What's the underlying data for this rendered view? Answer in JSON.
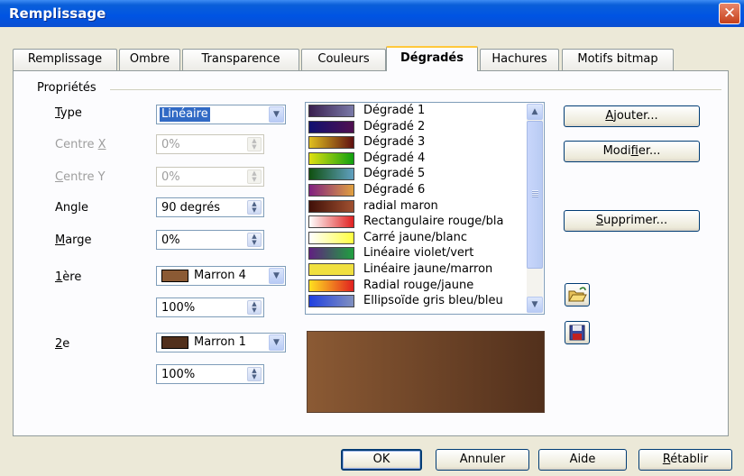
{
  "window": {
    "title": "Remplissage",
    "close_glyph": "✕"
  },
  "tabs": [
    {
      "label": "Remplissage",
      "active": false
    },
    {
      "label": "Ombre",
      "active": false
    },
    {
      "label": "Transparence",
      "active": false
    },
    {
      "label": "Couleurs",
      "active": false
    },
    {
      "label": "Dégradés",
      "active": true
    },
    {
      "label": "Hachures",
      "active": false
    },
    {
      "label": "Motifs bitmap",
      "active": false
    }
  ],
  "properties": {
    "group_label": "Propriétés",
    "type": {
      "label_pre": "",
      "label_u": "T",
      "label_post": "ype",
      "value": "Linéaire"
    },
    "center_x": {
      "label_pre": "Centre ",
      "label_u": "X",
      "label_post": "",
      "value": "0%",
      "enabled": false
    },
    "center_y": {
      "label_pre": "",
      "label_u": "C",
      "label_post": "entre Y",
      "value": "0%",
      "enabled": false
    },
    "angle": {
      "label_pre": "",
      "label_u": "",
      "label_post": "Angle",
      "value": "90 degrés"
    },
    "margin": {
      "label_pre": "",
      "label_u": "M",
      "label_post": "arge",
      "value": "0%"
    },
    "first": {
      "label_pre": "",
      "label_u": "1",
      "label_post": "ère",
      "color_name": "Marron 4",
      "color": "#8b5a34",
      "intensity": "100%"
    },
    "second": {
      "label_pre": "",
      "label_u": "2",
      "label_post": "e",
      "color_name": "Marron 1",
      "color": "#52301c",
      "intensity": "100%"
    }
  },
  "gradients": [
    {
      "name": "Dégradé 1",
      "c1": "#3a2050",
      "c2": "#7a7aa8"
    },
    {
      "name": "Dégradé 2",
      "c1": "#101070",
      "c2": "#501050"
    },
    {
      "name": "Dégradé 3",
      "c1": "#e0c020",
      "c2": "#601010"
    },
    {
      "name": "Dégradé 4",
      "c1": "#e0e010",
      "c2": "#10a010"
    },
    {
      "name": "Dégradé 5",
      "c1": "#105010",
      "c2": "#60a0c0"
    },
    {
      "name": "Dégradé 6",
      "c1": "#802080",
      "c2": "#e0a040"
    },
    {
      "name": "radial maron",
      "c1": "#401008",
      "c2": "#a05030"
    },
    {
      "name": "Rectangulaire rouge/bla",
      "c1": "#ffffff",
      "c2": "#e02020"
    },
    {
      "name": "Carré jaune/blanc",
      "c1": "#ffffff",
      "c2": "#ffff40"
    },
    {
      "name": "Linéaire violet/vert",
      "c1": "#602080",
      "c2": "#20a040"
    },
    {
      "name": "Linéaire jaune/marron",
      "c1": "#f0e040",
      "c2": "#f0e040"
    },
    {
      "name": "Radial rouge/jaune",
      "c1": "#ffe020",
      "c2": "#e02020"
    },
    {
      "name": "Ellipsoïde gris bleu/bleu",
      "c1": "#2040e0",
      "c2": "#8090c0"
    }
  ],
  "buttons": {
    "add": {
      "pre": "",
      "u": "A",
      "post": "jouter..."
    },
    "modify": {
      "pre": "Modi",
      "u": "f",
      "post": "ier..."
    },
    "delete": {
      "pre": "",
      "u": "S",
      "post": "upprimer..."
    },
    "ok": "OK",
    "cancel": "Annuler",
    "help": "Aide",
    "reset": {
      "pre": "",
      "u": "R",
      "post": "établir"
    }
  },
  "icons": {
    "open": "folder-open-icon",
    "save": "floppy-save-icon"
  },
  "colors": {
    "accent": "#0054e3",
    "preview_start": "#8b5a34",
    "preview_end": "#52301c"
  }
}
